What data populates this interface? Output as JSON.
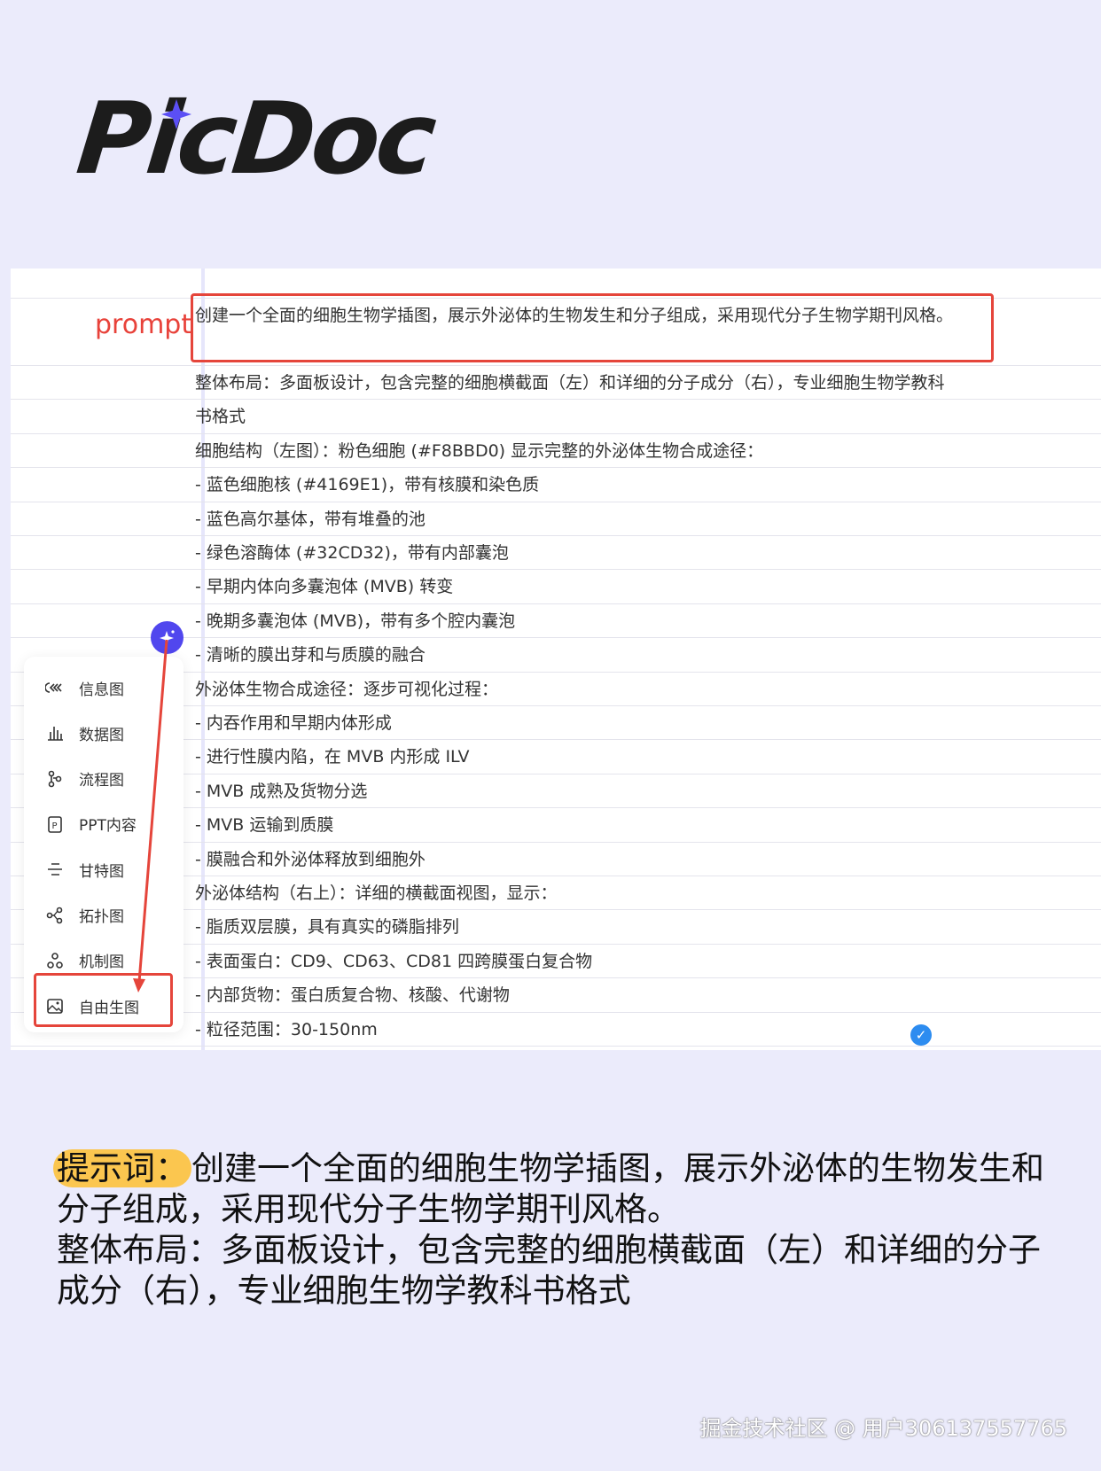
{
  "logo": {
    "text": "PicDoc"
  },
  "sheet": {
    "prompt_label": "prompt",
    "rows": [
      "创建一个全面的细胞生物学插图，展示外泌体的生物发生和分子组成，采用现代分子生物学期刊风格。",
      "整体布局：多面板设计，包含完整的细胞横截面（左）和详细的分子成分（右），专业细胞生物学教科",
      "书格式",
      "细胞结构（左图）：粉色细胞 (#F8BBD0) 显示完整的外泌体生物合成途径：",
      "- 蓝色细胞核 (#4169E1)，带有核膜和染色质",
      "- 蓝色高尔基体，带有堆叠的池",
      "- 绿色溶酶体 (#32CD32)，带有内部囊泡",
      "- 早期内体向多囊泡体 (MVB) 转变",
      "- 晚期多囊泡体 (MVB)，带有多个腔内囊泡",
      "- 清晰的膜出芽和与质膜的融合",
      "外泌体生物合成途径：逐步可视化过程：",
      "- 内吞作用和早期内体形成",
      "- 进行性膜内陷，在 MVB 内形成 ILV",
      "- MVB 成熟及货物分选",
      "- MVB 运输到质膜",
      "- 膜融合和外泌体释放到细胞外",
      "外泌体结构（右上）：详细的横截面视图，显示：",
      "- 脂质双层膜，具有真实的磷脂排列",
      "- 表面蛋白：CD9、CD63、CD81 四跨膜蛋白复合物",
      "- 内部货物：蛋白质复合物、核酸、代谢物",
      "- 粒径范围：30-150nm"
    ]
  },
  "menu": {
    "items": [
      "信息图",
      "数据图",
      "流程图",
      "PPT内容",
      "甘特图",
      "拓扑图",
      "机制图",
      "自由生图"
    ]
  },
  "caption": {
    "label": "提示词：",
    "text": "创建一个全面的细胞生物学插图，展示外泌体的生物发生和分子组成，采用现代分子生物学期刊风格。",
    "text2": "整体布局：多面板设计，包含完整的细胞横截面（左）和详细的分子成分（右），专业细胞生物学教科书格式"
  },
  "watermark": "掘金技术社区 @ 用户306137557765",
  "colors": {
    "accent": "#5147ee",
    "highlight": "#e5453b",
    "marker": "#fbc64f"
  }
}
